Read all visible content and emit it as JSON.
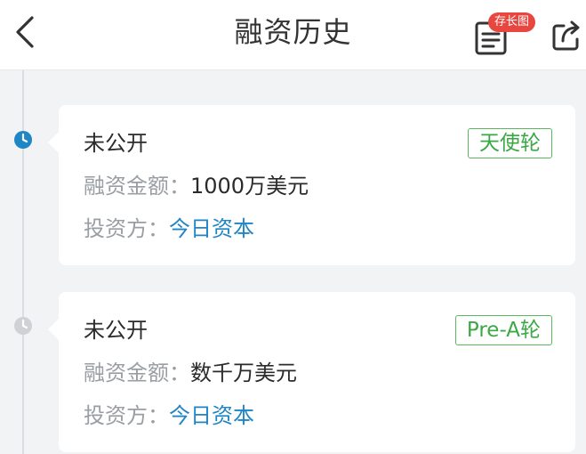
{
  "header": {
    "title": "融资历史",
    "save_badge": "存长图",
    "icons": {
      "back": "chevron-left-icon",
      "save": "document-icon",
      "share": "share-icon"
    }
  },
  "colors": {
    "active_dot": "#1f86c6",
    "inactive_dot": "#cfd1d4",
    "tag_green": "#3aa845",
    "link_blue": "#1f86c6",
    "badge_red": "#e8473f"
  },
  "rounds": [
    {
      "company": "未公开",
      "round": "天使轮",
      "amount_label": "融资金额：",
      "amount": "1000万美元",
      "investor_label": "投资方：",
      "investor": "今日资本",
      "active": true
    },
    {
      "company": "未公开",
      "round": "Pre-A轮",
      "amount_label": "融资金额：",
      "amount": "数千万美元",
      "investor_label": "投资方：",
      "investor": "今日资本",
      "active": false
    }
  ]
}
